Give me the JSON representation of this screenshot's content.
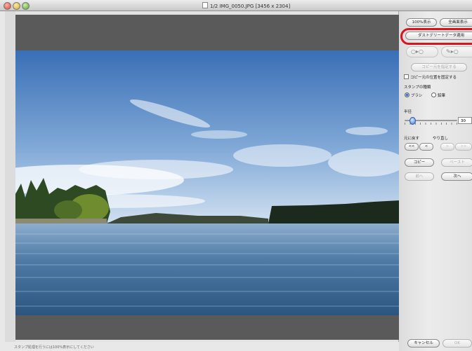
{
  "window": {
    "title": "1/2 IMG_0050.JPG  [3456 x 2304]"
  },
  "panel": {
    "zoom_100_label": "100%表示",
    "fit_screen_label": "全画面表示",
    "dust_delete_label": "ダストデリートデータ適用",
    "copy_source_button_label": "コピー元を指定する",
    "fix_copy_source_label": "コピー元の位置を固定する",
    "stamp_type_label": "スタンプの種類",
    "stamp_types": [
      "ブラシ",
      "鉛筆"
    ],
    "selected_stamp_type": "ブラシ",
    "radius_label": "半径",
    "radius_value": "30",
    "undo_label": "元に戻す",
    "redo_label": "やり直し",
    "undo_all_label": "<<",
    "undo_one_label": "<",
    "redo_one_label": ">",
    "redo_all_label": ">>",
    "copy_label": "コピー",
    "paste_label": "ペースト",
    "prev_label": "前へ",
    "next_label": "次へ",
    "cancel_label": "キャンセル",
    "ok_label": "OK"
  },
  "status": {
    "text": "スタンプ処理を行うには100%表示にしてください"
  },
  "colors": {
    "highlight": "#d8141c",
    "radio_selected": "#1a55c4"
  }
}
